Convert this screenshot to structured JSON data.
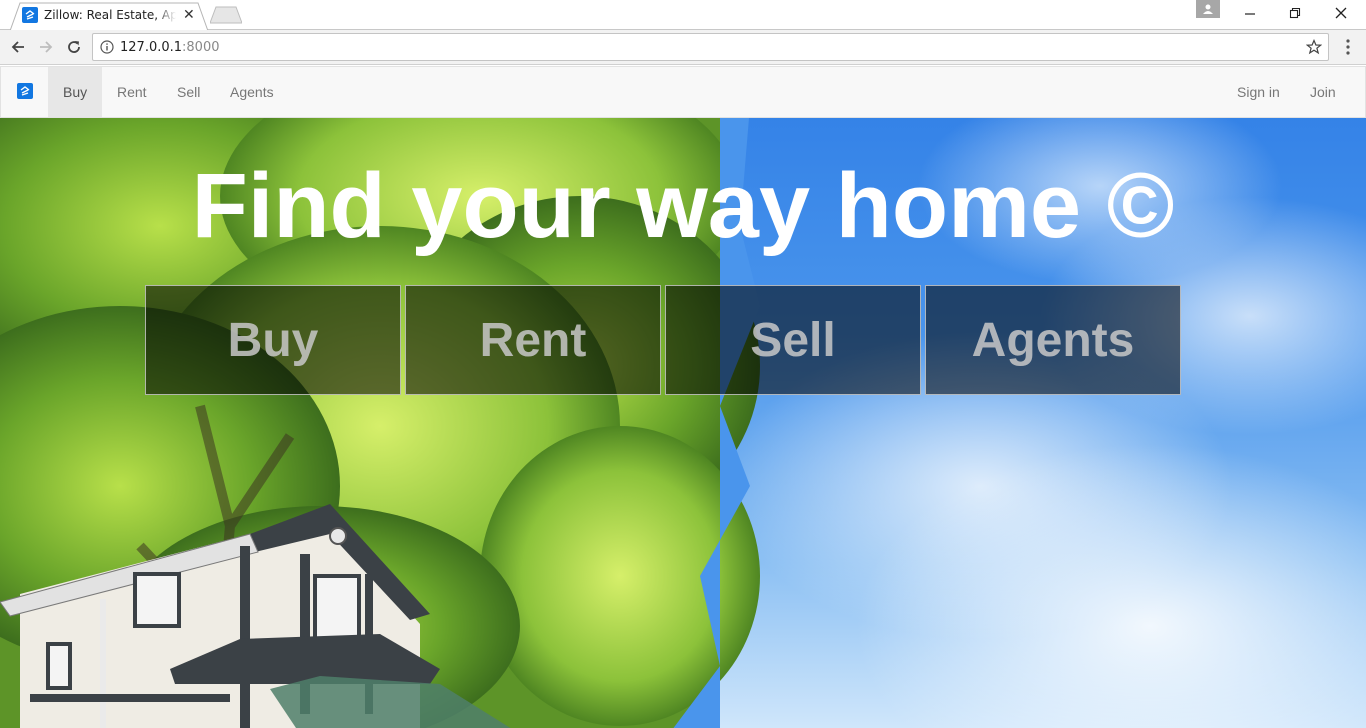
{
  "browser": {
    "tab_title": "Zillow: Real Estate, Apartments",
    "url_host": "127.0.0.1",
    "url_port": ":8000"
  },
  "navbar": {
    "links": [
      "Buy",
      "Rent",
      "Sell",
      "Agents"
    ],
    "active": "Buy",
    "right_links": [
      "Sign in",
      "Join"
    ]
  },
  "hero": {
    "title": "Find your way home ©",
    "buttons": [
      "Buy",
      "Rent",
      "Sell",
      "Agents"
    ]
  },
  "colors": {
    "brand_blue": "#1277e1",
    "sky": "#2f7ee6"
  },
  "icons": [
    "favicon-icon",
    "close-icon",
    "back-icon",
    "forward-icon",
    "reload-icon",
    "info-icon",
    "star-icon",
    "menu-icon",
    "user-icon",
    "minimize-icon",
    "restore-icon",
    "window-close-icon",
    "logo-icon"
  ]
}
